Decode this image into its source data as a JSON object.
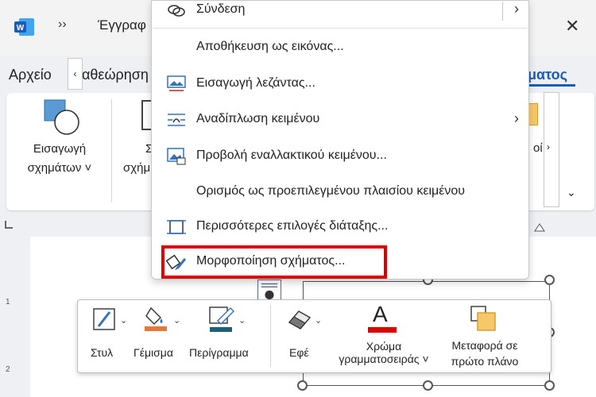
{
  "title_bar": {
    "more_label": "››",
    "doc_title": "Έγγραφ",
    "close_label": "✕"
  },
  "tabs": {
    "file": "Αρχείο",
    "view_partial": "αθεώρηση",
    "active_partial": "ματος",
    "scroll_left": "‹"
  },
  "ribbon": {
    "shapes_label_1": "Εισαγωγή",
    "shapes_label_2": "σχημάτων ˅",
    "partial_label_1": "Σ",
    "partial_label_2": "σχήμ",
    "right_partial": "οί",
    "scroll_right": "›",
    "expand": "⌄"
  },
  "ruler": {
    "num1": "1",
    "num2": "2"
  },
  "context_menu": {
    "items": [
      {
        "label": "Σύνδεση",
        "icon": "link-icon",
        "submenu": true
      },
      {
        "label": "Αποθήκευση ως εικόνας...",
        "icon": "",
        "submenu": false
      },
      {
        "label": "Εισαγωγή λεζάντας...",
        "icon": "caption-icon",
        "submenu": false
      },
      {
        "label": "Αναδίπλωση κειμένου",
        "icon": "wrap-text-icon",
        "submenu": true
      },
      {
        "label": "Προβολή εναλλακτικού κειμένου...",
        "icon": "alt-text-icon",
        "submenu": false
      },
      {
        "label": "Ορισμός ως προεπιλεγμένου πλαισίου κειμένου",
        "icon": "",
        "submenu": false
      },
      {
        "label": "Περισσότερες επιλογές διάταξης...",
        "icon": "layout-options-icon",
        "submenu": false
      },
      {
        "label": "Μορφοποίηση σχήματος...",
        "icon": "format-shape-icon",
        "submenu": false
      }
    ],
    "submenu_glyph": "›"
  },
  "mini_toolbar": {
    "style": "Στυλ",
    "fill": "Γέμισμα",
    "outline": "Περίγραμμα",
    "effects": "Εφέ",
    "font_color_1": "Χρώμα",
    "font_color_2": "γραμματοσειράς ˅",
    "font_letter": "A",
    "bring_front_1": "Μεταφορά σε",
    "bring_front_2": "πρώτο πλάνο",
    "caret": "⌄"
  },
  "colors": {
    "accent": "#185abd",
    "highlight": "#e00000",
    "fill_orange": "#e4793a",
    "outline_teal": "#1f5f7a",
    "font_red": "#e00000"
  }
}
